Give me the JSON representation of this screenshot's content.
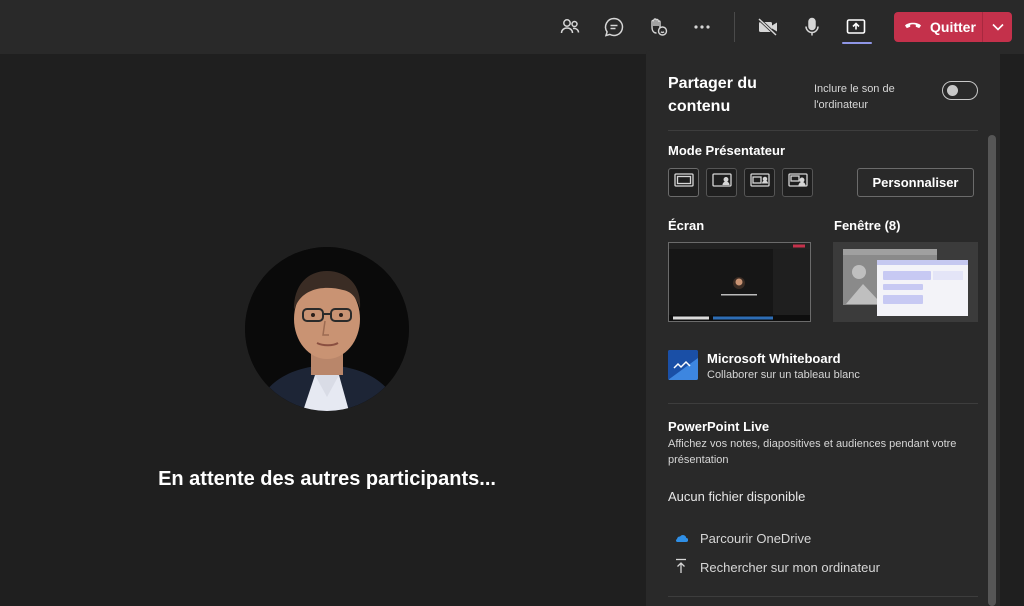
{
  "topbar": {
    "icons": [
      "participants-icon",
      "chat-icon",
      "raise-hand-icon",
      "more-icon",
      "camera-off-icon",
      "microphone-icon",
      "share-icon"
    ],
    "quit_label": "Quitter"
  },
  "stage": {
    "waiting_text": "En attente des autres participants..."
  },
  "panel": {
    "title": "Partager du contenu",
    "include_sound_label": "Inclure le son de l'ordinateur",
    "include_sound_on": false,
    "presenter_mode_label": "Mode Présentateur",
    "customize_label": "Personnaliser",
    "screen_label": "Écran",
    "window_label": "Fenêtre (8)",
    "whiteboard": {
      "title": "Microsoft Whiteboard",
      "subtitle": "Collaborer sur un tableau blanc"
    },
    "powerpoint": {
      "title": "PowerPoint Live",
      "subtitle": "Affichez vos notes, diapositives et audiences pendant votre présentation"
    },
    "no_file_label": "Aucun fichier disponible",
    "browse_onedrive": "Parcourir OneDrive",
    "search_computer": "Rechercher sur mon ordinateur"
  },
  "colors": {
    "quit_red": "#c4314b",
    "accent": "#8f96e6",
    "panel_bg": "#292929",
    "stage_bg": "#1f1f1f"
  }
}
